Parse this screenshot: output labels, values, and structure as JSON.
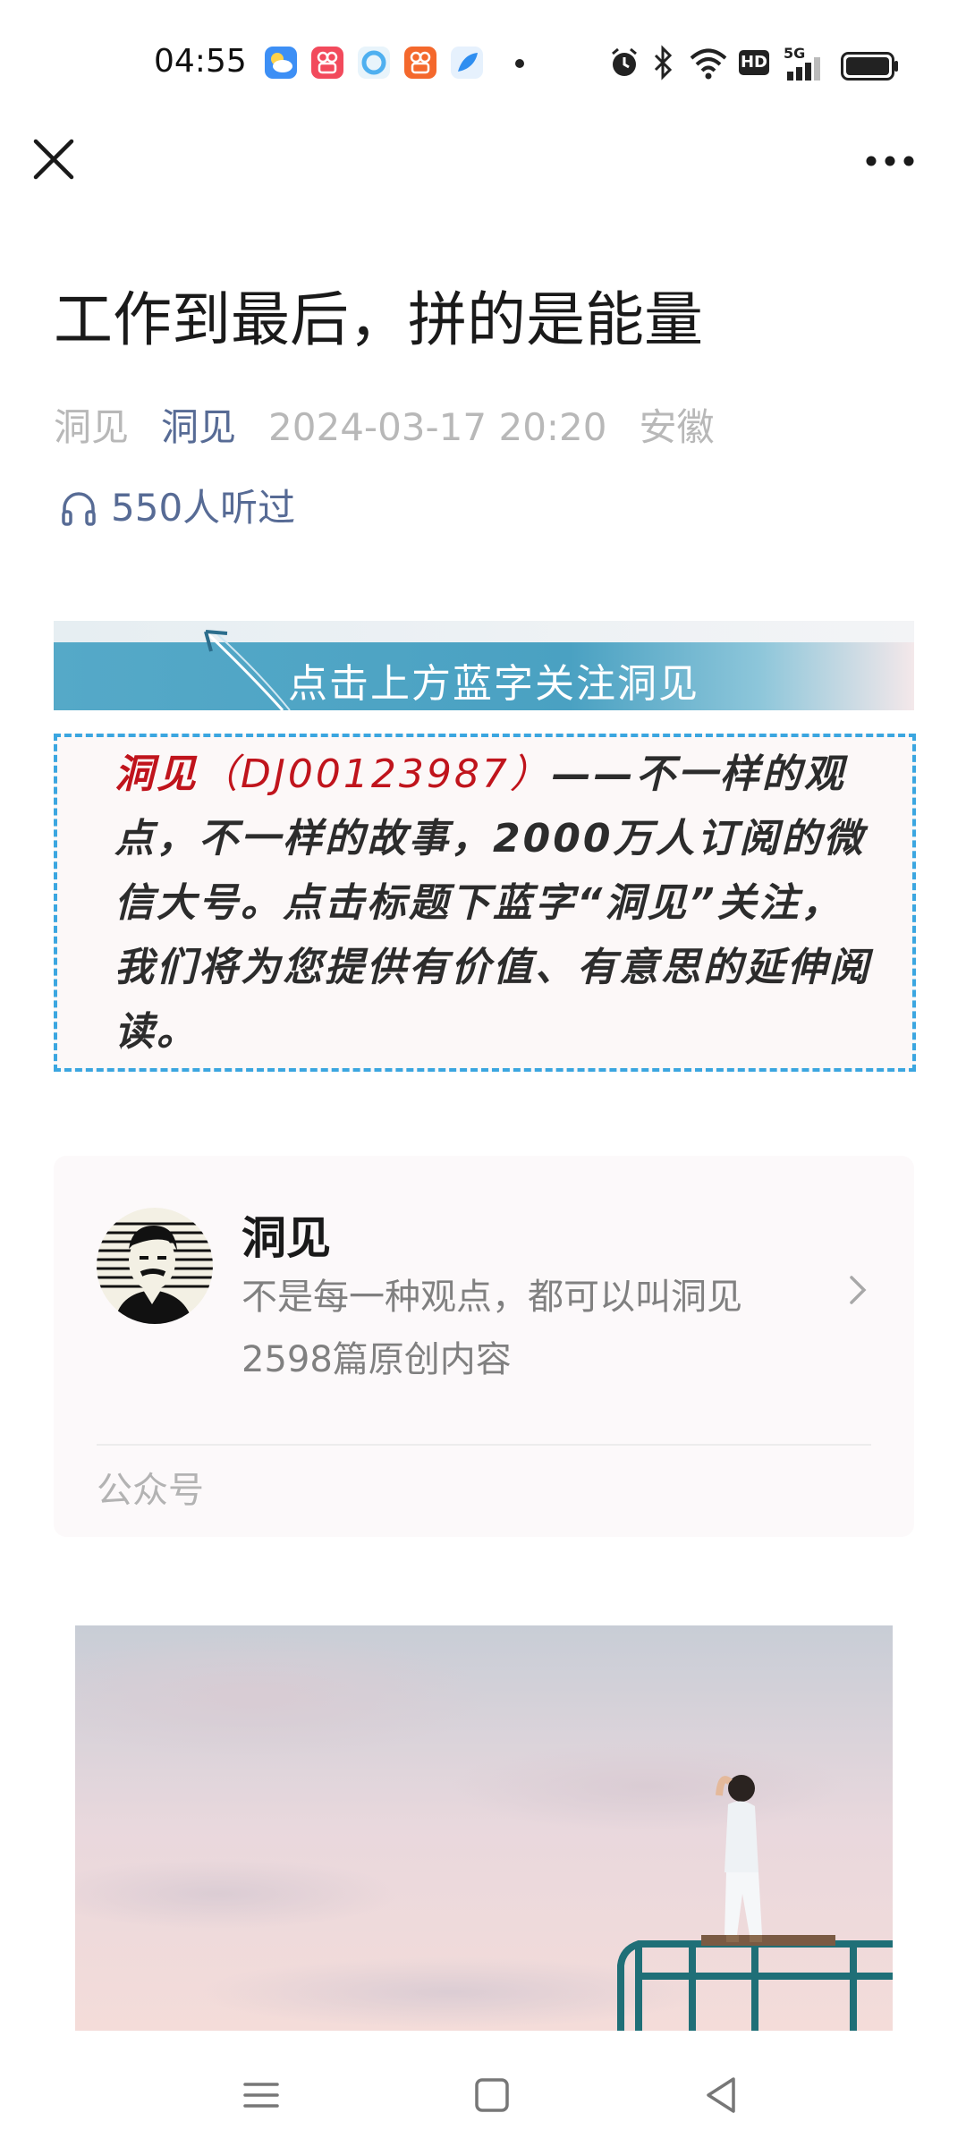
{
  "status_bar": {
    "time": "04:55",
    "app_icons": [
      {
        "name": "weather-app-icon",
        "color": "#3d8ff5"
      },
      {
        "name": "kuaishou-app-icon",
        "color": "#f24a5c"
      },
      {
        "name": "browser-app-icon",
        "color": "#4fb0f0"
      },
      {
        "name": "kuaishou-app-icon",
        "color": "#f4682c"
      },
      {
        "name": "feather-app-icon",
        "color": "#2f8ef0"
      }
    ],
    "icons": [
      "alarm-icon",
      "bluetooth-icon",
      "wifi-icon",
      "hd-icon",
      "5g-signal-icon",
      "battery-icon"
    ],
    "hd_label": "HD",
    "network_label": "5G"
  },
  "nav": {
    "close_icon": "close-icon",
    "more_icon": "more-icon"
  },
  "article": {
    "title": "工作到最后，拼的是能量",
    "author": "洞见",
    "account": "洞见",
    "datetime": "2024-03-17 20:20",
    "location": "安徽",
    "listen_count": "550人听过"
  },
  "banner": {
    "text": "点击上方蓝字关注洞见"
  },
  "intro": {
    "name": "洞见",
    "id": "（DJ00123987）",
    "body": "——不一样的观点，不一样的故事，2000万人订阅的微信大号。点击标题下蓝字“洞见”关注，我们将为您提供有价值、有意思的延伸阅读。"
  },
  "account_card": {
    "name": "洞见",
    "description": "不是每一种观点，都可以叫洞见",
    "count": "2598篇原创内容",
    "type_label": "公众号"
  },
  "colors": {
    "link": "#576b95",
    "accent_red": "#c0141c",
    "dashed_border": "#3ba6e0"
  }
}
